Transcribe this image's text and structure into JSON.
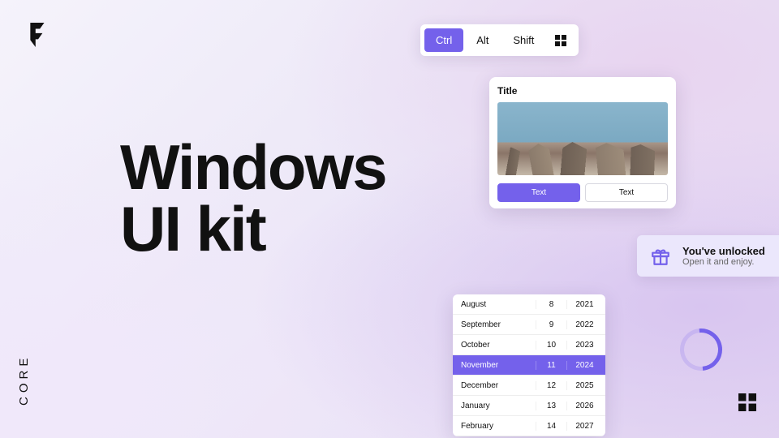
{
  "brand": {
    "logo_letter": "F",
    "sublabel": "CORE"
  },
  "headline": {
    "line1": "Windows",
    "line2": "UI kit"
  },
  "toolbar": {
    "items": [
      "Ctrl",
      "Alt",
      "Shift"
    ],
    "active_index": 0,
    "icon": "windows-grid-icon"
  },
  "card": {
    "title": "Title",
    "image_alt": "mountain-photo",
    "buttons": {
      "primary": "Text",
      "secondary": "Text"
    }
  },
  "toast": {
    "icon": "gift-icon",
    "title": "You've unlocked",
    "subtitle": "Open it and enjoy."
  },
  "datepicker": {
    "rows": [
      {
        "month": "August",
        "day": 8,
        "year": 2021
      },
      {
        "month": "September",
        "day": 9,
        "year": 2022
      },
      {
        "month": "October",
        "day": 10,
        "year": 2023
      },
      {
        "month": "November",
        "day": 11,
        "year": 2024
      },
      {
        "month": "December",
        "day": 12,
        "year": 2025
      },
      {
        "month": "January",
        "day": 13,
        "year": 2026
      },
      {
        "month": "February",
        "day": 14,
        "year": 2027
      }
    ],
    "selected_index": 3
  },
  "spinner": {
    "state": "loading"
  },
  "colors": {
    "accent": "#7461eb"
  }
}
